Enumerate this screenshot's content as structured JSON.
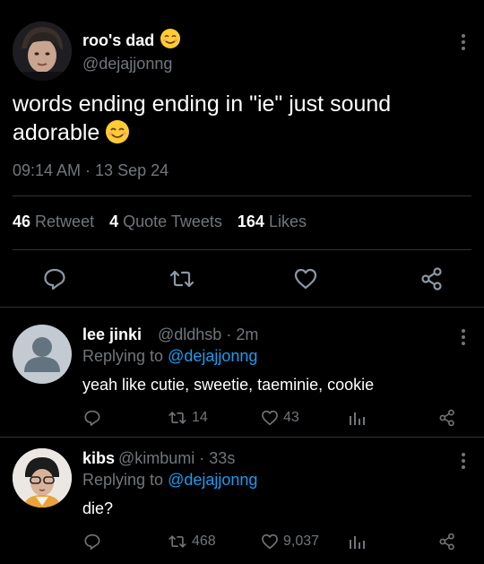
{
  "main_tweet": {
    "display_name": "roo's dad",
    "handle": "@dejajjonng",
    "text": "words ending ending in \"ie\" just sound adorable",
    "timestamp": "09:14 AM · 13 Sep 24",
    "retweets_count": "46",
    "retweets_label": "Retweet",
    "quotes_count": "4",
    "quotes_label": "Quote Tweets",
    "likes_count": "164",
    "likes_label": "Likes",
    "actions": [
      "reply-icon",
      "retweet-icon",
      "like-icon",
      "share-icon"
    ]
  },
  "replies": [
    {
      "display_name": "lee jinki",
      "handle": "@dldhsb",
      "time": "· 2m",
      "replying_label": "Replying to",
      "replying_to": "@dejajjonng",
      "text": "yeah like cutie, sweetie, taeminie, cookie",
      "retweets": "14",
      "likes": "43"
    },
    {
      "display_name": "kibs",
      "handle": "@kimbumi",
      "time": "· 33s",
      "replying_label": "Replying to",
      "replying_to": "@dejajjonng",
      "text": "die?",
      "retweets": "468",
      "likes": "9,037"
    }
  ],
  "colors": {
    "background": "#000000",
    "text": "#e7e9ea",
    "muted": "#71767b",
    "link": "#1d9bf0",
    "divider": "#2f3336",
    "emoji": "#ffcc33"
  }
}
